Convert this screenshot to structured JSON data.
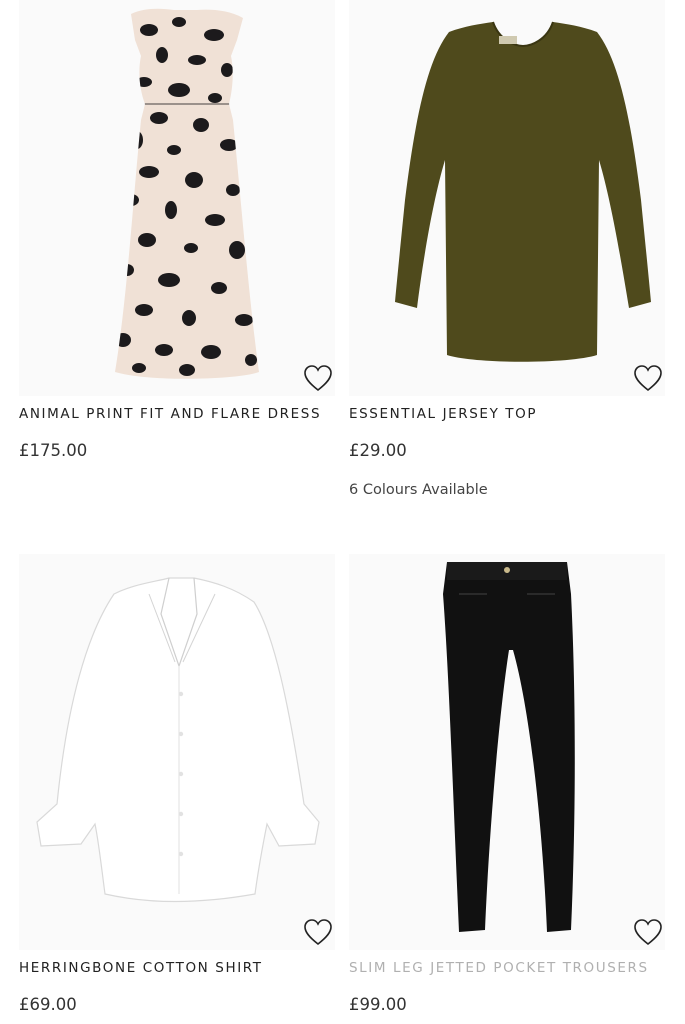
{
  "products": [
    {
      "title": "ANIMAL PRINT FIT AND FLARE DRESS",
      "price": "£175.00",
      "colours": "",
      "image": "leopard-print-dress",
      "color": "#f2e3d8",
      "print_color": "#1c1a1c"
    },
    {
      "title": "ESSENTIAL JERSEY TOP",
      "price": "£29.00",
      "colours": "6 Colours Available",
      "image": "olive-long-sleeve-top",
      "color": "#4f4a1c"
    },
    {
      "title": "HERRINGBONE COTTON SHIRT",
      "price": "£69.00",
      "colours": "",
      "image": "white-shirt",
      "color": "#ffffff"
    },
    {
      "title": "SLIM LEG JETTED POCKET TROUSERS",
      "price": "£99.00",
      "colours": "",
      "image": "black-trousers",
      "color": "#111111"
    }
  ],
  "icons": {
    "wishlist": "heart-outline-icon"
  }
}
